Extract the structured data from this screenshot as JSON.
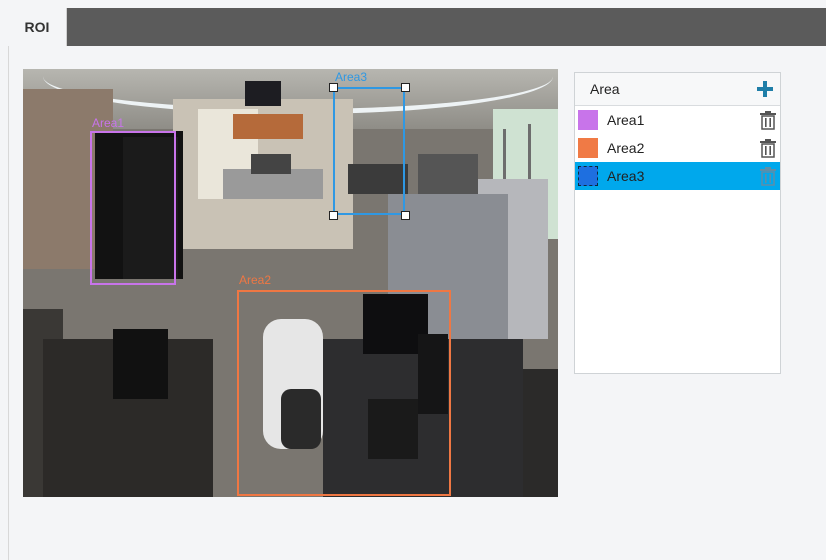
{
  "tab": {
    "label": "ROI"
  },
  "video": {
    "rois": [
      {
        "label": "Area1",
        "color": "#c874ea"
      },
      {
        "label": "Area2",
        "color": "#ef7743"
      },
      {
        "label": "Area3",
        "color": "#2f98e3"
      }
    ]
  },
  "panel": {
    "header": "Area",
    "add_icon": "plus-icon",
    "delete_icon": "trash-icon",
    "items": [
      {
        "label": "Area1",
        "color": "#c874ea",
        "selected": false
      },
      {
        "label": "Area2",
        "color": "#f07a45",
        "selected": false
      },
      {
        "label": "Area3",
        "color": "#1e6fe0",
        "selected": true
      }
    ],
    "selected_color": "#00a8ec"
  }
}
